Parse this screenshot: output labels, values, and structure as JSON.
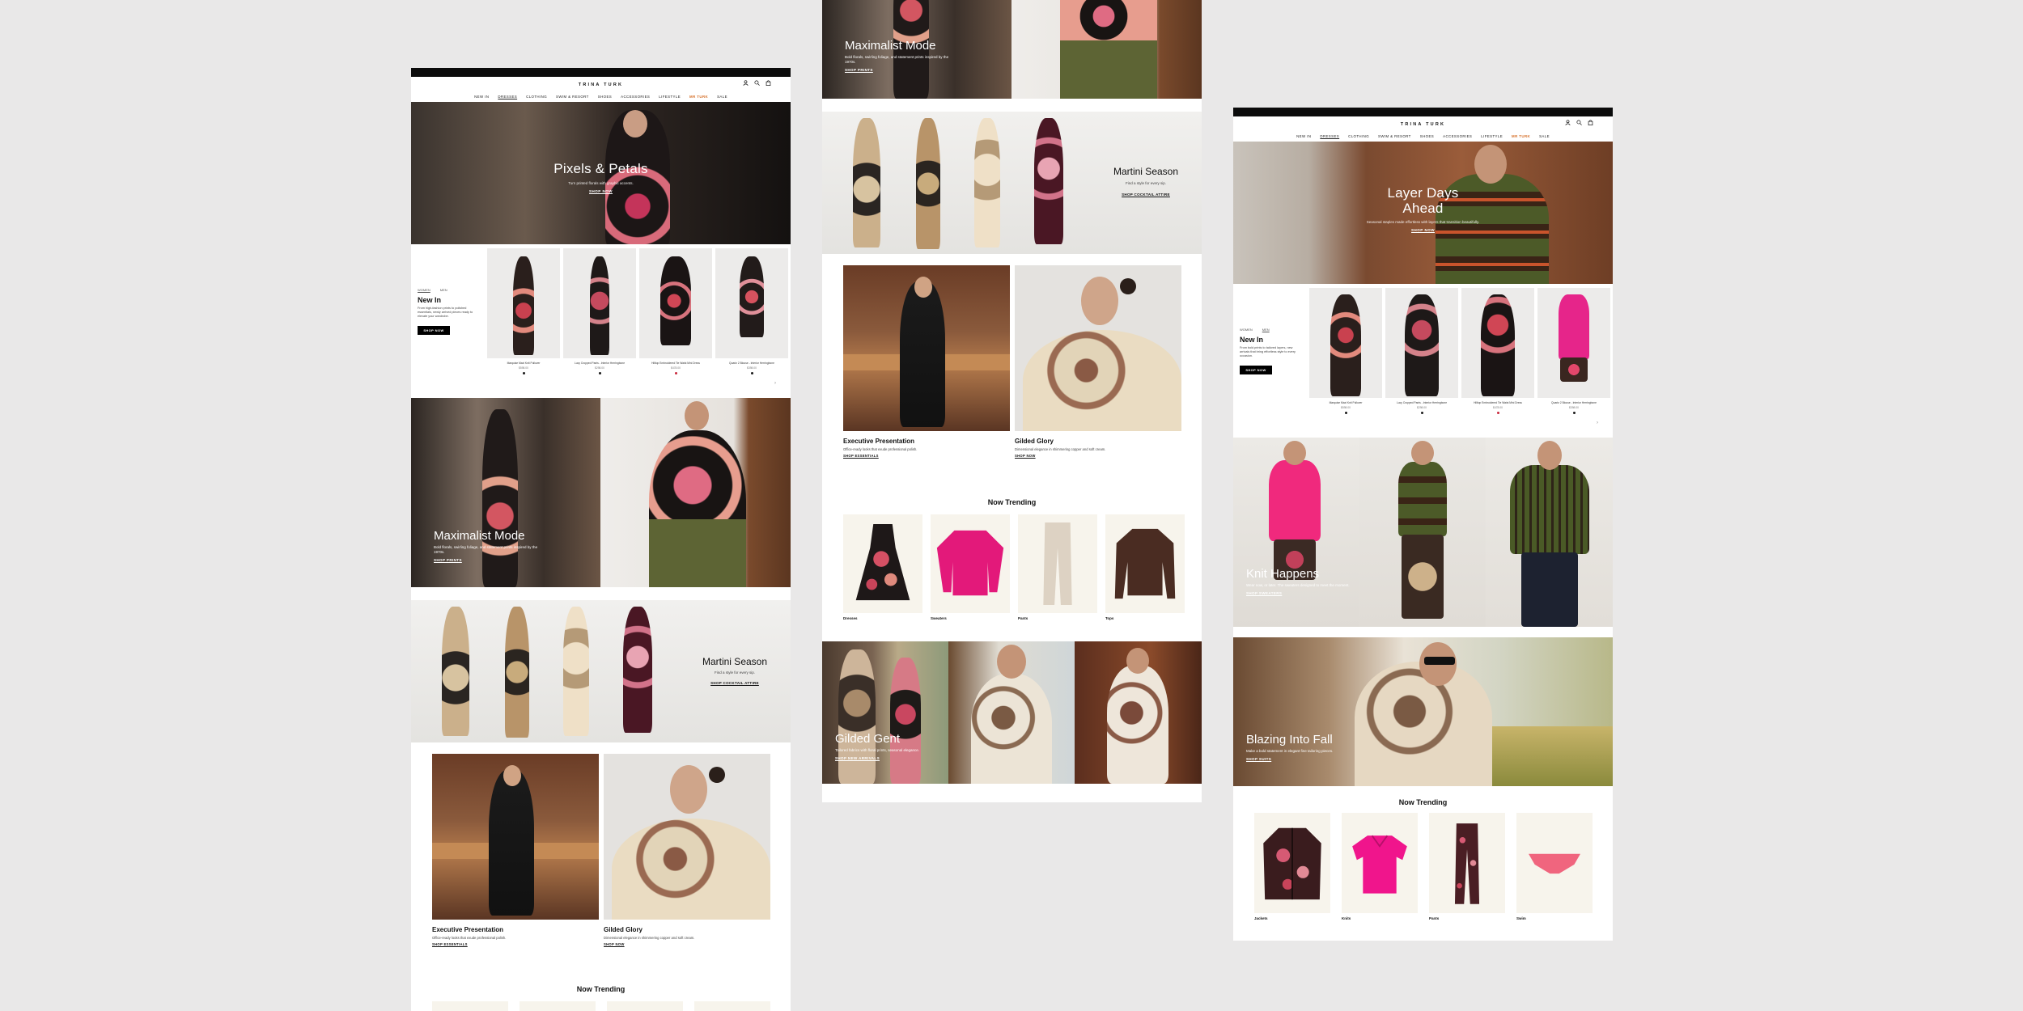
{
  "colors": {
    "background": "#e9e8e8",
    "accent": "#d6702a",
    "black": "#0b0b0b"
  },
  "header": {
    "logo": "TRINA TURK",
    "icons": [
      "user-icon",
      "search-icon",
      "bag-icon"
    ],
    "nav": [
      "NEW IN",
      "DRESSES",
      "CLOTHING",
      "SWIM & RESORT",
      "SHOES",
      "ACCESSORIES",
      "LIFESTYLE",
      "MR TURK",
      "SALE"
    ],
    "active_nav": "DRESSES",
    "accent_nav": "MR TURK"
  },
  "panelA": {
    "hero": {
      "title": "Pixels & Petals",
      "subtitle": "Turn printed florals with graphic accents.",
      "cta": "SHOP NOW"
    },
    "new_in": {
      "tabs": [
        "WOMEN",
        "MEN"
      ],
      "title": "New In",
      "description": "From high-fashion prints to polished essentials, newly arrived pieces ready to elevate your wardrobe.",
      "button": "SHOP NOW",
      "products": [
        {
          "name": "Marquise Maxi Knit Pullover",
          "price": "$598.00",
          "dot": "#1a1a1a"
        },
        {
          "name": "Lucy Cropped Pants - Interior Herringbone",
          "price": "$298.00",
          "dot": "#1a1a1a"
        },
        {
          "name": "Hilltop Embroidered Tie Waist Mini Dress",
          "price": "$478.00",
          "dot": "#c9283c"
        },
        {
          "name": "Quartz 2 Blouse - Interior Herringbone",
          "price": "$398.00",
          "dot": "#1a1a1a"
        }
      ]
    },
    "maximalist": {
      "title": "Maximalist Mode",
      "subtitle": "Bold florals, swirling foliage, and statement prints inspired by the 1970s.",
      "cta": "SHOP PRINTS"
    },
    "martini": {
      "title": "Martini Season",
      "subtitle": "Find a style for every sip.",
      "cta": "SHOP COCKTAIL ATTIRE"
    },
    "executive": {
      "title": "Executive Presentation",
      "subtitle": "Office-ready looks that exude professional polish.",
      "cta": "SHOP ESSENTIALS"
    },
    "gilded": {
      "title": "Gilded Glory",
      "subtitle": "Dimensional elegance in shimmering copper and soft cream.",
      "cta": "SHOP NOW"
    },
    "trending_title": "Now Trending"
  },
  "panelB": {
    "maximalist": {
      "title": "Maximalist Mode",
      "subtitle": "Bold florals, swirling foliage, and statement prints inspired by the 1970s.",
      "cta": "SHOP PRINTS"
    },
    "martini": {
      "title": "Martini Season",
      "subtitle": "Find a style for every sip.",
      "cta": "SHOP COCKTAIL ATTIRE"
    },
    "executive": {
      "title": "Executive Presentation",
      "subtitle": "Office-ready looks that exude professional polish.",
      "cta": "SHOP ESSENTIALS"
    },
    "gilded": {
      "title": "Gilded Glory",
      "subtitle": "Dimensional elegance in shimmering copper and soft cream.",
      "cta": "SHOP NOW"
    },
    "trending": {
      "title": "Now Trending",
      "items": [
        {
          "label": "Dresses",
          "kind": "dress-icon"
        },
        {
          "label": "Sweaters",
          "kind": "sweater-icon"
        },
        {
          "label": "Pants",
          "kind": "pants-icon"
        },
        {
          "label": "Tops",
          "kind": "top-icon"
        }
      ]
    },
    "gilded_gent": {
      "title": "Gilded Gent",
      "subtitle": "Tailored fabrics with floral prints, seasonal elegance.",
      "cta": "SHOP NEW ARRIVALS"
    }
  },
  "panelC": {
    "hero": {
      "title_line1": "Layer Days",
      "title_line2": "Ahead",
      "subtitle": "Seasonal staples made effortless with layers that transition beautifully.",
      "cta": "SHOP NOW"
    },
    "new_in": {
      "tabs": [
        "WOMEN",
        "MEN"
      ],
      "title": "New In",
      "description": "From bold prints to tailored layers, new arrivals that bring effortless style to every occasion.",
      "button": "SHOP NOW",
      "products": [
        {
          "name": "Marquise Maxi Knit Pullover",
          "price": "$598.00",
          "dot": "#1a1a1a"
        },
        {
          "name": "Lucy Cropped Pants - Interior Herringbone",
          "price": "$298.00",
          "dot": "#1a1a1a"
        },
        {
          "name": "Hilltop Embroidered Tie Waist Mini Dress",
          "price": "$478.00",
          "dot": "#c9283c"
        },
        {
          "name": "Quartz 2 Blouse - Interior Herringbone",
          "price": "$398.00",
          "dot": "#1a1a1a"
        }
      ]
    },
    "knit": {
      "title": "Knit Happens",
      "subtitle": "Wear now, or later. The sweaters designed to meet the moment.",
      "cta": "SHOP SWEATERS"
    },
    "blazing": {
      "title": "Blazing Into Fall",
      "subtitle": "Make a bold statement in elegant fine tailoring pieces.",
      "cta": "SHOP SUITS"
    },
    "trending": {
      "title": "Now Trending",
      "items": [
        {
          "label": "Jackets",
          "kind": "jacket-icon"
        },
        {
          "label": "Knits",
          "kind": "polo-icon"
        },
        {
          "label": "Pants",
          "kind": "pants-icon"
        },
        {
          "label": "Swim",
          "kind": "swim-icon"
        }
      ]
    }
  }
}
